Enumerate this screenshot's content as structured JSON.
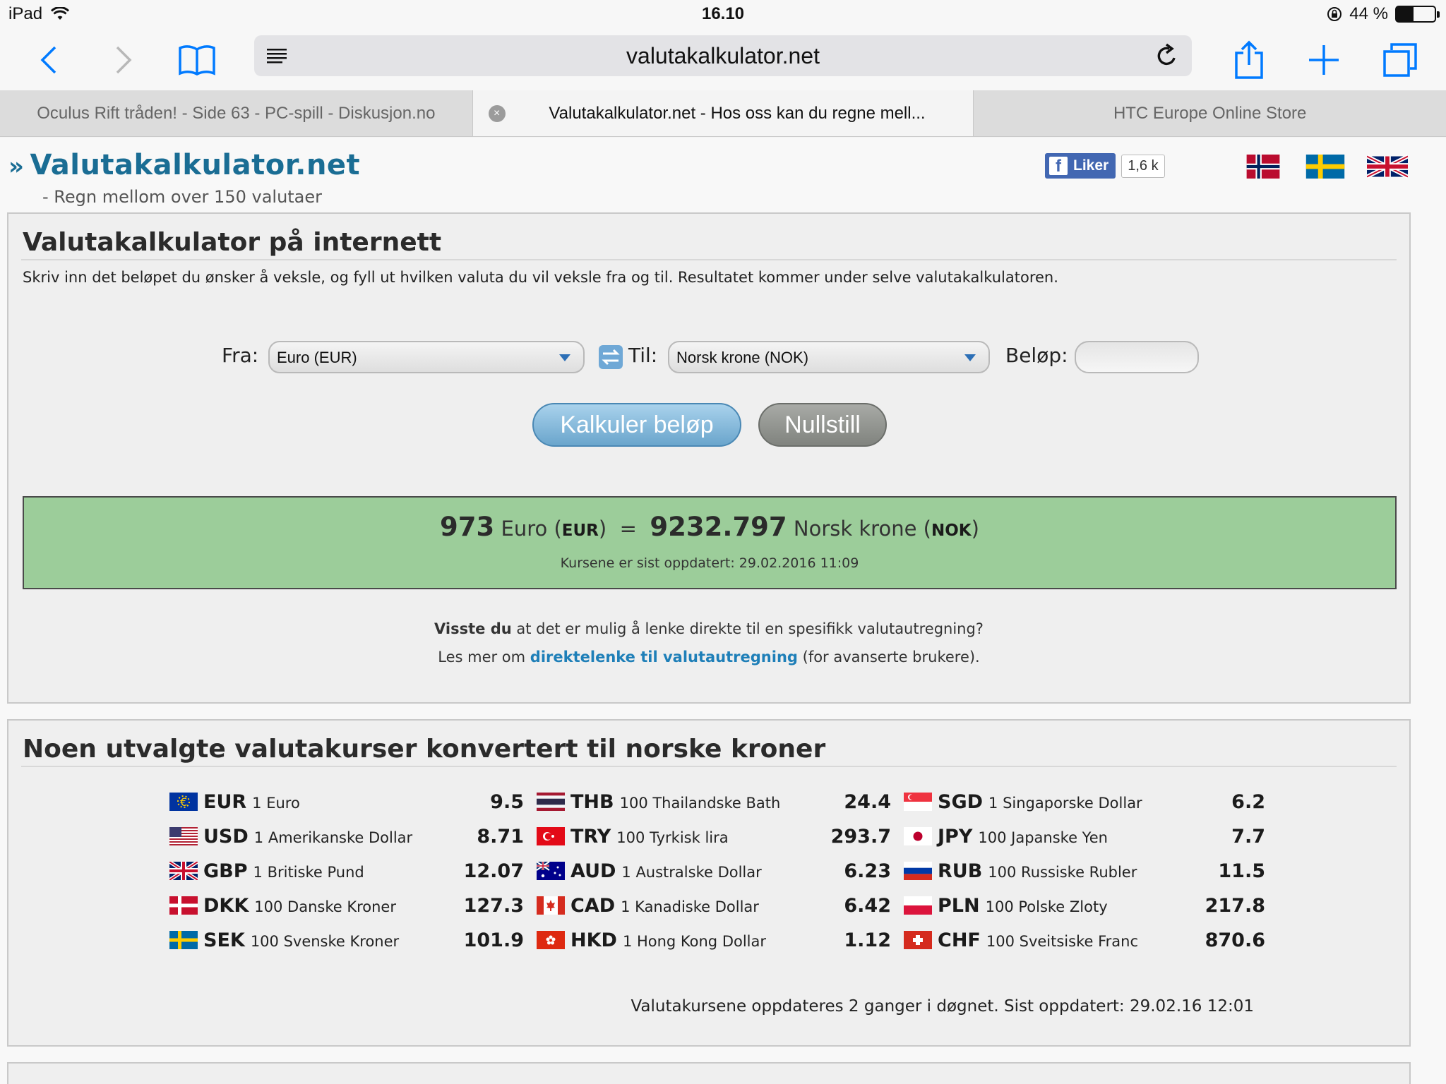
{
  "status": {
    "device": "iPad",
    "time": "16.10",
    "battery": "44 %",
    "battery_level": 0.44
  },
  "browser": {
    "url": "valutakalkulator.net",
    "tabs": [
      {
        "label": "Oculus Rift tråden! - Side 63 - PC-spill - Diskusjon.no"
      },
      {
        "label": "Valutakalkulator.net - Hos oss kan du regne mell..."
      },
      {
        "label": "HTC Europe Online Store"
      }
    ]
  },
  "site": {
    "logo": "Valutakalkulator.net",
    "slogan": "- Regn mellom over 150 valutaer",
    "fb_like": "Liker",
    "fb_count": "1,6 k"
  },
  "calculator": {
    "title": "Valutakalkulator på internett",
    "intro": "Skriv inn det beløpet du ønsker å veksle, og fyll ut hvilken valuta du vil veksle fra og til. Resultatet kommer under selve valutakalkulatoren.",
    "from_label": "Fra:",
    "from_value": "Euro (EUR)",
    "to_label": "Til:",
    "to_value": "Norsk krone (NOK)",
    "amount_label": "Beløp:",
    "amount_value": "",
    "calc_button": "Kalkuler beløp",
    "reset_button": "Nullstill"
  },
  "result": {
    "amount": "973",
    "from_name": "Euro",
    "from_code": "EUR",
    "equals": "=",
    "value": "9232.797",
    "to_name": "Norsk krone",
    "to_code": "NOK",
    "updated": "Kursene er sist oppdatert: 29.02.2016 11:09"
  },
  "tip": {
    "bold": "Visste du",
    "line1_rest": "at det er mulig å lenke direkte til en spesifikk valutautregning?",
    "line2_pre": "Les mer om",
    "link": "direktelenke til valutautregning",
    "line2_post": "(for avanserte brukere)."
  },
  "rates": {
    "title": "Noen utvalgte valutakurser konvertert til norske kroner",
    "columns": [
      [
        {
          "code": "EUR",
          "name": "1 Euro",
          "value": "9.5",
          "flag": "eu"
        },
        {
          "code": "USD",
          "name": "1 Amerikanske Dollar",
          "value": "8.71",
          "flag": "us"
        },
        {
          "code": "GBP",
          "name": "1 Britiske Pund",
          "value": "12.07",
          "flag": "gb"
        },
        {
          "code": "DKK",
          "name": "100 Danske Kroner",
          "value": "127.3",
          "flag": "dk"
        },
        {
          "code": "SEK",
          "name": "100 Svenske Kroner",
          "value": "101.9",
          "flag": "se"
        }
      ],
      [
        {
          "code": "THB",
          "name": "100 Thailandske Bath",
          "value": "24.4",
          "flag": "th"
        },
        {
          "code": "TRY",
          "name": "100 Tyrkisk lira",
          "value": "293.7",
          "flag": "tr"
        },
        {
          "code": "AUD",
          "name": "1 Australske Dollar",
          "value": "6.23",
          "flag": "au"
        },
        {
          "code": "CAD",
          "name": "1 Kanadiske Dollar",
          "value": "6.42",
          "flag": "ca"
        },
        {
          "code": "HKD",
          "name": "1 Hong Kong Dollar",
          "value": "1.12",
          "flag": "hk"
        }
      ],
      [
        {
          "code": "SGD",
          "name": "1 Singaporske Dollar",
          "value": "6.2",
          "flag": "sg"
        },
        {
          "code": "JPY",
          "name": "100 Japanske Yen",
          "value": "7.7",
          "flag": "jp"
        },
        {
          "code": "RUB",
          "name": "100 Russiske Rubler",
          "value": "11.5",
          "flag": "ru"
        },
        {
          "code": "PLN",
          "name": "100 Polske Zloty",
          "value": "217.8",
          "flag": "pl"
        },
        {
          "code": "CHF",
          "name": "100 Sveitsiske Franc",
          "value": "870.6",
          "flag": "ch"
        }
      ]
    ],
    "note": "Valutakursene oppdateres 2 ganger i døgnet. Sist oppdatert: 29.02.16 12:01"
  },
  "colors": {
    "ios_blue": "#007aff",
    "logo_blue": "#1a6d94",
    "link_blue": "#1e7fb8",
    "result_green": "#9ccd9a"
  }
}
